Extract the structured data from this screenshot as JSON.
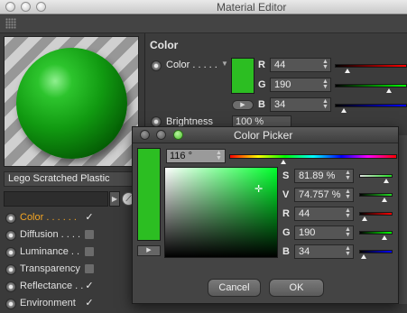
{
  "window": {
    "title": "Material Editor"
  },
  "material": {
    "name": "Lego Scratched Plastic"
  },
  "channels": [
    {
      "label": "Color",
      "dots": " . . . . . .",
      "checked": true,
      "active": true
    },
    {
      "label": "Diffusion",
      "dots": ". . . . .",
      "checked": false,
      "active": false
    },
    {
      "label": "Luminance",
      "dots": ". .",
      "checked": false,
      "active": false
    },
    {
      "label": "Transparency",
      "dots": "",
      "checked": false,
      "active": false
    },
    {
      "label": "Reflectance",
      "dots": ". .",
      "checked": true,
      "active": false
    },
    {
      "label": "Environment",
      "dots": "",
      "checked": true,
      "active": false
    }
  ],
  "color_section": {
    "title": "Color",
    "color_label": "Color . . . . .",
    "swatch_color": "#2cbe22",
    "r": {
      "label": "R",
      "value": "44",
      "level": 0.17
    },
    "g": {
      "label": "G",
      "value": "190",
      "level": 0.75
    },
    "b": {
      "label": "B",
      "value": "34",
      "level": 0.13
    },
    "brightness_label": "Brightness",
    "brightness_value": "100 %"
  },
  "color_picker": {
    "title": "Color Picker",
    "hue": "116 °",
    "hue_level": 0.32,
    "s": {
      "label": "S",
      "value": "81.89 %",
      "level": 0.82
    },
    "v": {
      "label": "V",
      "value": "74.757 %",
      "level": 0.75
    },
    "r": {
      "label": "R",
      "value": "44",
      "level": 0.17
    },
    "g": {
      "label": "G",
      "value": "190",
      "level": 0.75
    },
    "b": {
      "label": "B",
      "value": "34",
      "level": 0.13
    },
    "cancel_label": "Cancel",
    "ok_label": "OK"
  },
  "colors": {
    "accent_active": "#f5a623",
    "material_green": "#2cbe22"
  },
  "icons": [
    "close-icon",
    "minimize-icon",
    "zoom-icon",
    "grip-icon",
    "play-icon",
    "eyedropper-icon",
    "check-icon",
    "crosshair-icon"
  ]
}
